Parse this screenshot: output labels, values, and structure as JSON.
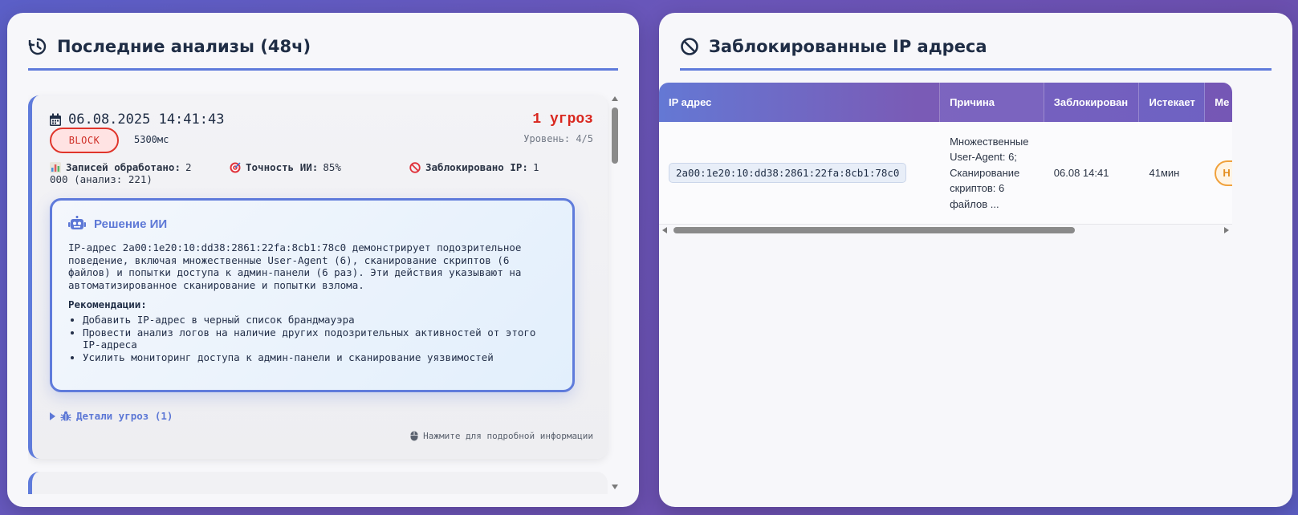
{
  "left_panel": {
    "title": "Последние анализы (48ч)",
    "icon": "history-icon",
    "analysis": {
      "datetime": "06.08.2025 14:41:43",
      "threats": "1 угроз",
      "level": "Уровень: 4/5",
      "action_badge": "BLOCK",
      "duration": "5300мс",
      "stats": {
        "records_label": "Записей обработано:",
        "records_value": "2",
        "records_value_cont": "000 (анализ: 221)",
        "accuracy_label": "Точность ИИ:",
        "accuracy_value": "85%",
        "blocked_label": "Заблокировано IP:",
        "blocked_value": "1"
      },
      "ai_decision": {
        "title": "Решение ИИ",
        "text": "IP-адрес 2a00:1e20:10:dd38:2861:22fa:8cb1:78c0 демонстрирует подозрительное поведение, включая множественные User-Agent (6), сканирование скриптов (6 файлов) и попытки доступа к админ-панели (6 раз). Эти действия указывают на автоматизированное сканирование и попытки взлома.",
        "recommendations_title": "Рекомендации:",
        "recommendations": [
          "Добавить IP-адрес в черный список брандмауэра",
          "Провести анализ логов на наличие других подозрительных активностей от этого IP-адреса",
          "Усилить мониторинг доступа к админ-панели и сканирование уязвимостей"
        ]
      },
      "details_label": "Детали угроз (1)",
      "hint": "Нажмите для подробной информации"
    }
  },
  "right_panel": {
    "title": "Заблокированные IP адреса",
    "icon": "ban-icon",
    "table": {
      "columns": [
        "IP адрес",
        "Причина",
        "Заблокирован",
        "Истекает",
        "Ме"
      ],
      "rows": [
        {
          "ip": "2a00:1e20:10:dd38:2861:22fa:8cb1:78c0",
          "reason": "Множественные User-Agent: 6; Сканирование скриптов: 6 файлов ...",
          "blocked_at": "06.08 14:41",
          "expires": "41мин",
          "action": "Н"
        }
      ]
    }
  },
  "colors": {
    "accent": "#5f7bdb",
    "danger": "#d9271f",
    "warning": "#f0a13c"
  }
}
